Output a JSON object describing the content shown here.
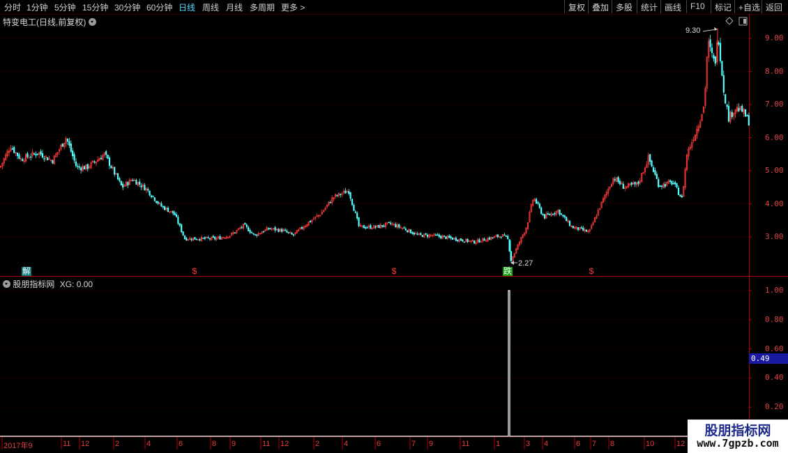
{
  "toolbar": {
    "periods": [
      "分时",
      "1分钟",
      "5分钟",
      "15分钟",
      "30分钟",
      "60分钟",
      "日线",
      "周线",
      "月线",
      "多周期",
      "更多 >"
    ],
    "active_period": "日线",
    "right_buttons": [
      "复权",
      "叠加",
      "多股",
      "统计",
      "画线",
      "F10",
      "标记",
      "+自选",
      "返回"
    ]
  },
  "main_pane": {
    "title": "特变电工(日线,前复权)",
    "high_label": "9.30",
    "low_label": "2.27",
    "y_ticks": [
      "9.00",
      "8.00",
      "7.00",
      "6.00",
      "5.00",
      "4.00",
      "3.00"
    ],
    "markers": [
      {
        "text": "解",
        "kind": "unlock"
      },
      {
        "text": "$",
        "kind": "dividend"
      },
      {
        "text": "$",
        "kind": "dividend"
      },
      {
        "text": "跌",
        "kind": "signal"
      },
      {
        "text": "$",
        "kind": "dividend"
      }
    ]
  },
  "indicator_pane": {
    "title": "股朋指标网",
    "formula": "XG: 0.00",
    "y_ticks": [
      "1.00",
      "0.80",
      "0.60",
      "0.40",
      "0.20"
    ],
    "current_value": "0.49"
  },
  "date_axis": [
    "2017年9",
    "11",
    "12",
    "2",
    "4",
    "6",
    "8",
    "9",
    "11",
    "12",
    "2",
    "4",
    "6",
    "7",
    "9",
    "11",
    "1",
    "3",
    "4",
    "6",
    "7",
    "8",
    "10",
    "12"
  ],
  "watermark": {
    "line1": "股朋指标网",
    "line2": "www.7gpzb.com"
  },
  "colors": {
    "up": "#ff3b3b",
    "down": "#54ffff",
    "grid": "#5a0000",
    "axis": "#b00000",
    "active": "#4fd8ff"
  },
  "chart_data": [
    {
      "type": "candlestick",
      "title": "特变电工(日线,前复权)",
      "ylim": [
        2.0,
        9.9
      ],
      "close_path": [
        [
          0,
          5.1
        ],
        [
          15,
          5.75
        ],
        [
          30,
          5.35
        ],
        [
          55,
          5.55
        ],
        [
          75,
          5.3
        ],
        [
          95,
          6.0
        ],
        [
          110,
          5.1
        ],
        [
          125,
          5.1
        ],
        [
          150,
          5.5
        ],
        [
          165,
          4.9
        ],
        [
          175,
          4.5
        ],
        [
          190,
          4.75
        ],
        [
          210,
          4.45
        ],
        [
          230,
          3.95
        ],
        [
          250,
          3.7
        ],
        [
          265,
          2.95
        ],
        [
          285,
          2.95
        ],
        [
          310,
          2.95
        ],
        [
          330,
          3.05
        ],
        [
          350,
          3.35
        ],
        [
          365,
          3.05
        ],
        [
          385,
          3.25
        ],
        [
          405,
          3.2
        ],
        [
          420,
          3.05
        ],
        [
          440,
          3.4
        ],
        [
          460,
          3.7
        ],
        [
          478,
          4.2
        ],
        [
          500,
          4.4
        ],
        [
          515,
          3.3
        ],
        [
          540,
          3.3
        ],
        [
          560,
          3.4
        ],
        [
          580,
          3.25
        ],
        [
          600,
          3.05
        ],
        [
          620,
          3.05
        ],
        [
          650,
          2.95
        ],
        [
          680,
          2.85
        ],
        [
          700,
          2.95
        ],
        [
          720,
          3.05
        ],
        [
          728,
          2.95
        ],
        [
          733,
          2.3
        ],
        [
          745,
          2.85
        ],
        [
          755,
          3.3
        ],
        [
          765,
          4.2
        ],
        [
          780,
          3.6
        ],
        [
          800,
          3.8
        ],
        [
          820,
          3.3
        ],
        [
          845,
          3.15
        ],
        [
          860,
          3.9
        ],
        [
          880,
          4.8
        ],
        [
          895,
          4.5
        ],
        [
          915,
          4.6
        ],
        [
          930,
          5.4
        ],
        [
          945,
          4.55
        ],
        [
          965,
          4.65
        ],
        [
          978,
          4.15
        ],
        [
          985,
          5.5
        ],
        [
          1000,
          6.3
        ],
        [
          1010,
          7.0
        ],
        [
          1015,
          8.9
        ],
        [
          1025,
          8.2
        ],
        [
          1030,
          9.1
        ],
        [
          1038,
          7.4
        ],
        [
          1045,
          6.6
        ],
        [
          1055,
          6.9
        ],
        [
          1065,
          6.8
        ],
        [
          1075,
          6.45
        ]
      ],
      "high": 9.3,
      "low": 2.27
    },
    {
      "type": "line",
      "title": "股朋指标网",
      "series": [
        {
          "name": "XG",
          "x_path_spike": 729,
          "values": [
            0,
            1
          ]
        }
      ],
      "ylim": [
        0,
        1.1
      ],
      "current": 0.49
    }
  ]
}
